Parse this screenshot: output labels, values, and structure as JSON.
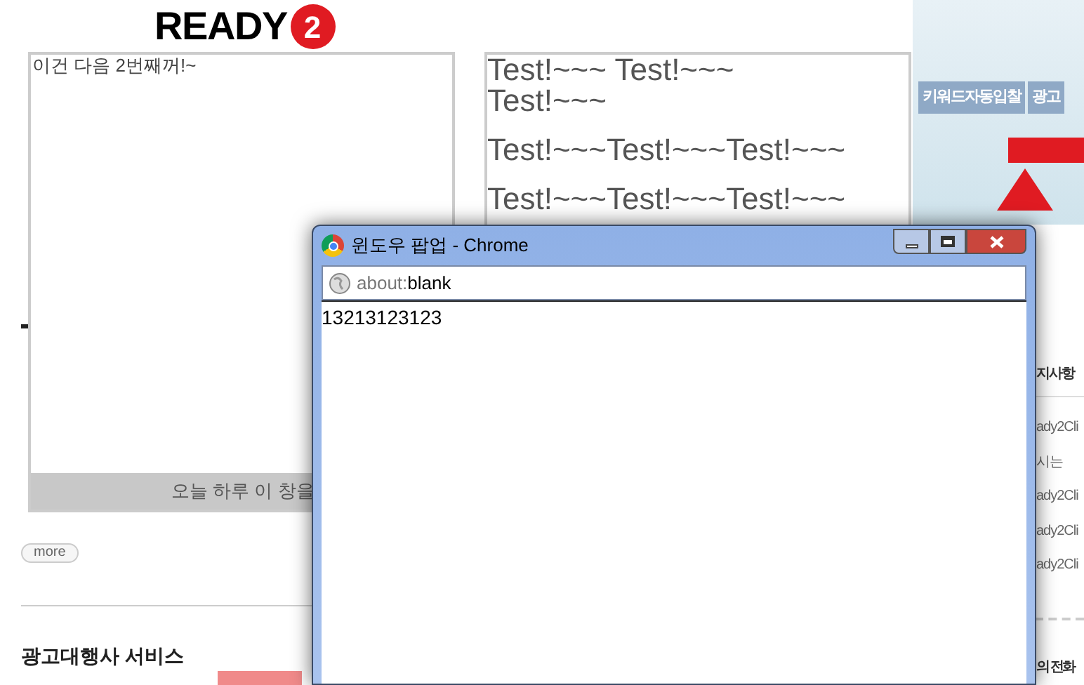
{
  "background_page": {
    "logo_text": "READY",
    "logo_badge": "2",
    "banner_tabs": [
      "키워드자동입찰",
      "광고"
    ],
    "more_button": "more",
    "section_title": "광고대행사 서비스",
    "notice_title": "지사항",
    "notice_items": [
      "ady2Cli",
      "시는",
      "ady2Cli",
      "ady2Cli",
      "ady2Cli"
    ],
    "phone_title": "의 전화"
  },
  "layer_popup": {
    "text": "이건 다음 2번째꺼!~",
    "footer": "오늘 하루 이 창을"
  },
  "test_popup": {
    "lines": [
      "Test!~~~ Test!~~~ Test!~~~",
      "Test!~~~Test!~~~Test!~~~",
      "Test!~~~Test!~~~Test!~~~"
    ]
  },
  "chrome_window": {
    "title": "윈도우 팝업 - Chrome",
    "address_scheme": "about:",
    "address_page": "blank",
    "content": "13213123123"
  }
}
